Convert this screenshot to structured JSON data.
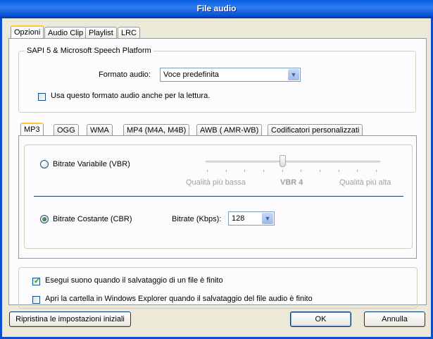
{
  "window": {
    "title": "File audio"
  },
  "tabs": [
    "Opzioni",
    "Audio Clip",
    "Playlist",
    "LRC"
  ],
  "sapi": {
    "group_title": "SAPI 5 & Microsoft Speech Platform",
    "format_label": "Formato audio:",
    "format_value": "Voce predefinita",
    "use_for_reading_label": "Usa questo formato audio anche per la lettura.",
    "use_for_reading_checked": false
  },
  "format_tabs": [
    "MP3",
    "OGG",
    "WMA",
    "MP4 (M4A, M4B)",
    "AWB ( AMR-WB)",
    "Codificatori personalizzati"
  ],
  "mp3": {
    "vbr_label": "Bitrate Variabile (VBR)",
    "vbr_selected": false,
    "slider_low_label": "Qualità più bassa",
    "slider_value_label": "VBR 4",
    "slider_high_label": "Qualità più alta",
    "slider_level": 4,
    "slider_max": 9,
    "cbr_label": "Bitrate Costante (CBR)",
    "cbr_selected": true,
    "bitrate_label": "Bitrate (Kbps):",
    "bitrate_value": "128"
  },
  "after_save": {
    "play_sound_label": "Esegui suono quando il salvataggio di un file è finito",
    "play_sound_checked": true,
    "open_folder_label": "Apri la cartella in Windows Explorer quando il salvataggio del file audio è finito",
    "open_folder_checked": false
  },
  "buttons": {
    "reset": "Ripristina le impostazioni iniziali",
    "ok": "OK",
    "cancel": "Annulla"
  },
  "colors": {
    "titlebar": "#0a5fe0",
    "dialog_bg": "#ece9d8",
    "panel_bg": "#fcfcfe",
    "check_green": "#21a121"
  }
}
